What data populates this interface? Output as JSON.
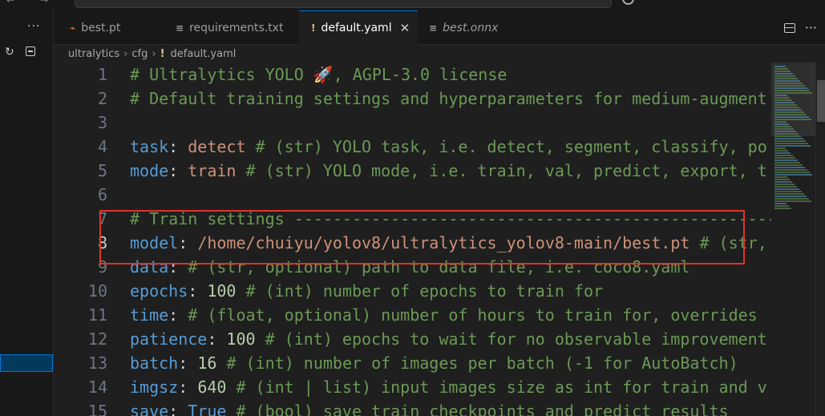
{
  "tabs": [
    {
      "label": "best.pt",
      "icon": "rss-icon",
      "icon_glyph": "⌁",
      "icon_color": "#e8803a",
      "active": false,
      "italic": false
    },
    {
      "label": "requirements.txt",
      "icon": "lines-icon",
      "icon_glyph": "≡",
      "icon_color": "#9d9d9d",
      "active": false,
      "italic": false
    },
    {
      "label": "default.yaml",
      "icon": "yaml-bang-icon",
      "icon_glyph": "!",
      "icon_color": "#e2c08d",
      "active": true,
      "italic": false
    },
    {
      "label": "best.onnx",
      "icon": "lines-icon",
      "icon_glyph": "≡",
      "icon_color": "#9d9d9d",
      "active": false,
      "italic": true
    }
  ],
  "tab_close_glyph": "✕",
  "tab_more_glyph": "···",
  "sidebar": {
    "more_glyph": "···",
    "refresh_glyph": "↻"
  },
  "breadcrumb": {
    "parts": [
      "ultralytics",
      "cfg"
    ],
    "file": "default.yaml",
    "file_icon_glyph": "!",
    "separator": "›"
  },
  "highlight_color": "#e0342b",
  "current_line": 8,
  "lines": [
    {
      "n": "1",
      "tokens": [
        {
          "t": "# Ultralytics YOLO 🚀, AGPL-3.0 license",
          "c": "comment"
        }
      ]
    },
    {
      "n": "2",
      "tokens": [
        {
          "t": "# Default training settings and hyperparameters for medium-augment",
          "c": "comment"
        }
      ]
    },
    {
      "n": "3",
      "tokens": []
    },
    {
      "n": "4",
      "tokens": [
        {
          "t": "task",
          "c": "key"
        },
        {
          "t": ": ",
          "c": "plain"
        },
        {
          "t": "detect",
          "c": "str"
        },
        {
          "t": " # (str) YOLO task, i.e. detect, segment, classify, po",
          "c": "comment"
        }
      ]
    },
    {
      "n": "5",
      "tokens": [
        {
          "t": "mode",
          "c": "key"
        },
        {
          "t": ": ",
          "c": "plain"
        },
        {
          "t": "train",
          "c": "str"
        },
        {
          "t": " # (str) YOLO mode, i.e. train, val, predict, export, t",
          "c": "comment"
        }
      ]
    },
    {
      "n": "6",
      "tokens": []
    },
    {
      "n": "7",
      "tokens": [
        {
          "t": "# Train settings --------------------------------------------------------",
          "c": "comment"
        }
      ]
    },
    {
      "n": "8",
      "tokens": [
        {
          "t": "model",
          "c": "key"
        },
        {
          "t": ": ",
          "c": "plain"
        },
        {
          "t": "/home/chuiyu/yolov8/ultralytics_yolov8-main/best.pt",
          "c": "str"
        },
        {
          "t": " # (str,",
          "c": "comment"
        }
      ]
    },
    {
      "n": "9",
      "tokens": [
        {
          "t": "data",
          "c": "key"
        },
        {
          "t": ": ",
          "c": "plain"
        },
        {
          "t": "# (str, optional) path to data file, i.e. coco8.yaml",
          "c": "comment"
        }
      ]
    },
    {
      "n": "10",
      "tokens": [
        {
          "t": "epochs",
          "c": "key"
        },
        {
          "t": ": ",
          "c": "plain"
        },
        {
          "t": "100",
          "c": "num"
        },
        {
          "t": " # (int) number of epochs to train for",
          "c": "comment"
        }
      ]
    },
    {
      "n": "11",
      "tokens": [
        {
          "t": "time",
          "c": "key"
        },
        {
          "t": ": ",
          "c": "plain"
        },
        {
          "t": "# (float, optional) number of hours to train for, overrides",
          "c": "comment"
        }
      ]
    },
    {
      "n": "12",
      "tokens": [
        {
          "t": "patience",
          "c": "key"
        },
        {
          "t": ": ",
          "c": "plain"
        },
        {
          "t": "100",
          "c": "num"
        },
        {
          "t": " # (int) epochs to wait for no observable improvement",
          "c": "comment"
        }
      ]
    },
    {
      "n": "13",
      "tokens": [
        {
          "t": "batch",
          "c": "key"
        },
        {
          "t": ": ",
          "c": "plain"
        },
        {
          "t": "16",
          "c": "num"
        },
        {
          "t": " # (int) number of images per batch (-1 for AutoBatch)",
          "c": "comment"
        }
      ]
    },
    {
      "n": "14",
      "tokens": [
        {
          "t": "imgsz",
          "c": "key"
        },
        {
          "t": ": ",
          "c": "plain"
        },
        {
          "t": "640",
          "c": "num"
        },
        {
          "t": " # (int | list) input images size as int for train and v",
          "c": "comment"
        }
      ]
    },
    {
      "n": "15",
      "tokens": [
        {
          "t": "save",
          "c": "key"
        },
        {
          "t": ": ",
          "c": "plain"
        },
        {
          "t": "True",
          "c": "bool"
        },
        {
          "t": " # (bool) save train checkpoints and predict results",
          "c": "comment"
        }
      ]
    }
  ]
}
